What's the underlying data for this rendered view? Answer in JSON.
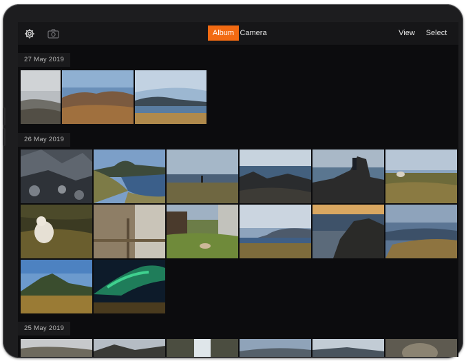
{
  "toolbar": {
    "settings_icon": "gear-icon",
    "camera_icon": "camera-icon",
    "tabs": [
      {
        "label": "Album",
        "active": true
      },
      {
        "label": "Camera",
        "active": false
      }
    ],
    "view_label": "View",
    "select_label": "Select"
  },
  "colors": {
    "accent": "#f26a12",
    "background": "#0c0c0e",
    "toolbar": "#161618"
  },
  "sections": [
    {
      "date": "27 May 2019",
      "photo_count": 3
    },
    {
      "date": "26 May 2019",
      "photo_count": 14
    },
    {
      "date": "25 May 2019",
      "photo_count": 6
    }
  ]
}
